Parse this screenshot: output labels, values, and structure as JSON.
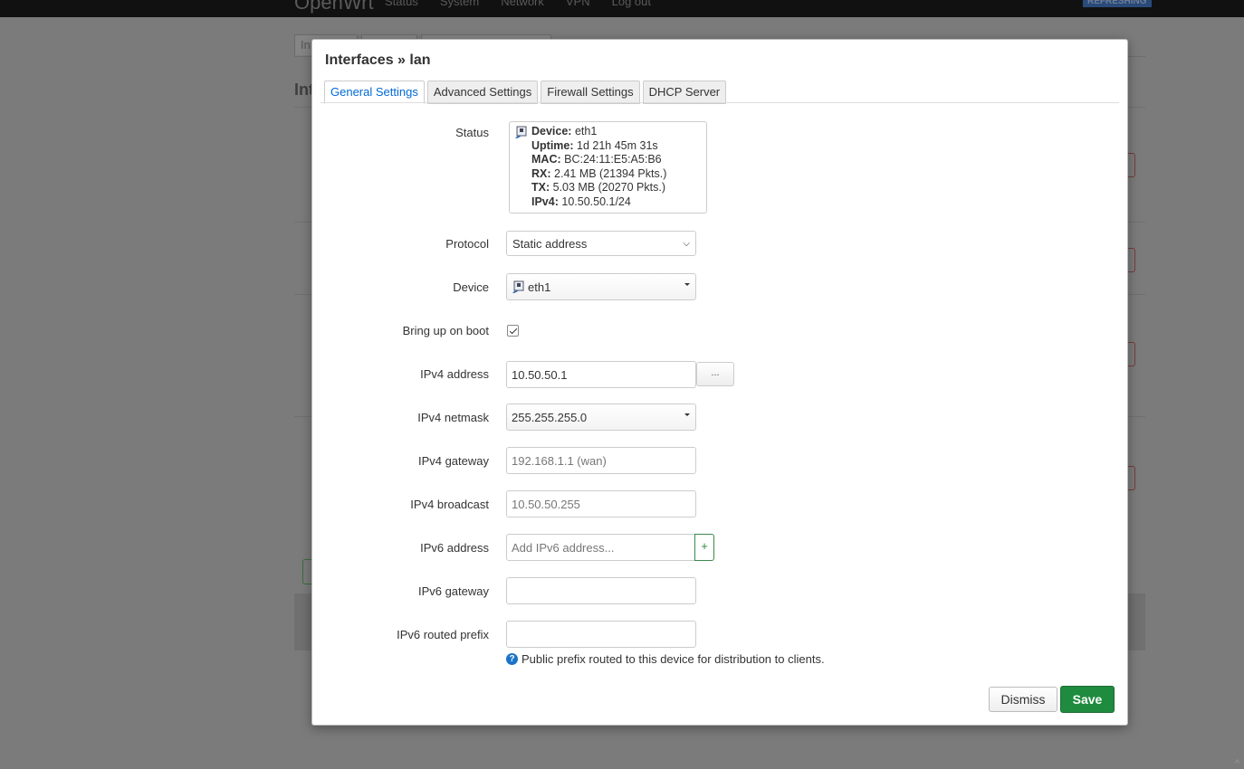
{
  "background": {
    "brand": "OpenWrt",
    "nav": [
      "Status",
      "System",
      "Network",
      "VPN",
      "Log out"
    ],
    "refresh_badge": "REFRESHING",
    "tabs": [
      "Int",
      "",
      ""
    ],
    "title": "Int"
  },
  "modal": {
    "title": "Interfaces » lan",
    "tabs": [
      {
        "label": "General Settings",
        "active": true
      },
      {
        "label": "Advanced Settings",
        "active": false
      },
      {
        "label": "Firewall Settings",
        "active": false
      },
      {
        "label": "DHCP Server",
        "active": false
      }
    ],
    "status": {
      "label": "Status",
      "device_key": "Device:",
      "device_val": "eth1",
      "uptime_key": "Uptime:",
      "uptime_val": "1d 21h 45m 31s",
      "mac_key": "MAC:",
      "mac_val": "BC:24:11:E5:A5:B6",
      "rx_key": "RX:",
      "rx_val": "2.41 MB (21394 Pkts.)",
      "tx_key": "TX:",
      "tx_val": "5.03 MB (20270 Pkts.)",
      "ipv4_key": "IPv4:",
      "ipv4_val": "10.50.50.1/24"
    },
    "protocol": {
      "label": "Protocol",
      "value": "Static address"
    },
    "device": {
      "label": "Device",
      "value": "eth1"
    },
    "boot": {
      "label": "Bring up on boot",
      "checked": true
    },
    "ipv4_address": {
      "label": "IPv4 address",
      "value": "10.50.50.1",
      "button": "..."
    },
    "ipv4_netmask": {
      "label": "IPv4 netmask",
      "value": "255.255.255.0"
    },
    "ipv4_gateway": {
      "label": "IPv4 gateway",
      "placeholder": "192.168.1.1 (wan)"
    },
    "ipv4_broadcast": {
      "label": "IPv4 broadcast",
      "placeholder": "10.50.50.255"
    },
    "ipv6_address": {
      "label": "IPv6 address",
      "placeholder": "Add IPv6 address...",
      "button": "+"
    },
    "ipv6_gateway": {
      "label": "IPv6 gateway",
      "value": ""
    },
    "ipv6_prefix": {
      "label": "IPv6 routed prefix",
      "value": "",
      "hint": "Public prefix routed to this device for distribution to clients."
    },
    "buttons": {
      "dismiss": "Dismiss",
      "save": "Save"
    }
  },
  "colors": {
    "accent": "#0069d6",
    "save": "#1e8b3e",
    "plus": "#2b8a3e"
  }
}
